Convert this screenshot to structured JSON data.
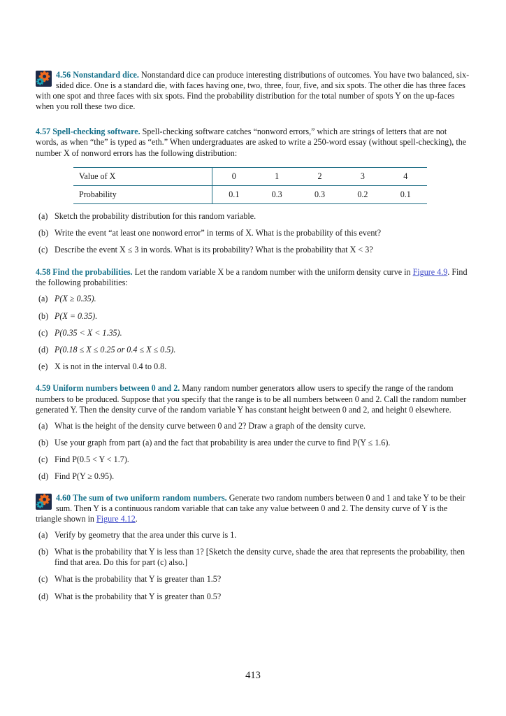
{
  "page": {
    "folio": "413",
    "heading_color": "#15708a",
    "link_color": "#3a46c8",
    "rule_color": "#1b6b83"
  },
  "icons": {
    "gear_badge": "gears-icon"
  },
  "exercises": [
    {
      "id": "4.56",
      "has_icon": true,
      "number": "4.56",
      "title": "Nonstandard dice.",
      "body": "Nonstandard dice can produce interesting distributions of outcomes. You have two balanced, six-sided dice. One is a standard die, with faces having one, two, three, four, five, and six spots. The other die has three faces with one spot and three faces with six spots. Find the probability distribution for the total number of spots Y on the up-faces when you roll these two dice."
    },
    {
      "id": "4.57",
      "has_icon": false,
      "number": "4.57",
      "title": "Spell-checking software.",
      "body": "Spell-checking software catches “nonword errors,” which are strings of letters that are not words, as when “the” is typed as “eth.” When undergraduates are asked to write a 250-word essay (without spell-checking), the number X of nonword errors has the following distribution:",
      "table": {
        "row_labels": [
          "Value of X",
          "Probability"
        ],
        "values_x": [
          "0",
          "1",
          "2",
          "3",
          "4"
        ],
        "values_p": [
          "0.1",
          "0.3",
          "0.3",
          "0.2",
          "0.1"
        ]
      },
      "parts": [
        {
          "tag": "(a)",
          "text": "Sketch the probability distribution for this random variable."
        },
        {
          "tag": "(b)",
          "text": "Write the event “at least one nonword error” in terms of X. What is the probability of this event?"
        },
        {
          "tag": "(c)",
          "text": "Describe the event X ≤ 3 in words. What is its probability? What is the probability that X < 3?"
        }
      ]
    },
    {
      "id": "4.58",
      "has_icon": false,
      "number": "4.58",
      "title": "Find the probabilities.",
      "body_pre": "Let the random variable X be a random number with the uniform density curve in ",
      "link": "Figure 4.9",
      "body_post": ". Find the following probabilities:",
      "parts": [
        {
          "tag": "(a)",
          "text": "P(X ≥ 0.35)."
        },
        {
          "tag": "(b)",
          "text": "P(X = 0.35)."
        },
        {
          "tag": "(c)",
          "text": "P(0.35 < X < 1.35)."
        },
        {
          "tag": "(d)",
          "text": "P(0.18 ≤ X ≤ 0.25 or 0.4 ≤ X ≤ 0.5)."
        },
        {
          "tag": "(e)",
          "text": "X is not in the interval 0.4 to 0.8."
        }
      ]
    },
    {
      "id": "4.59",
      "has_icon": false,
      "number": "4.59",
      "title": "Uniform numbers between 0 and 2.",
      "body": "Many random number generators allow users to specify the range of the random numbers to be produced. Suppose that you specify that the range is to be all numbers between 0 and 2. Call the random number generated Y. Then the density curve of the random variable Y has constant height between 0 and 2, and height 0 elsewhere.",
      "parts": [
        {
          "tag": "(a)",
          "text": "What is the height of the density curve between 0 and 2? Draw a graph of the density curve."
        },
        {
          "tag": "(b)",
          "text": "Use your graph from part (a) and the fact that probability is area under the curve to find P(Y ≤ 1.6)."
        },
        {
          "tag": "(c)",
          "text": "Find P(0.5 < Y < 1.7)."
        },
        {
          "tag": "(d)",
          "text": "Find P(Y ≥ 0.95)."
        }
      ]
    },
    {
      "id": "4.60",
      "has_icon": true,
      "number": "4.60",
      "title": "The sum of two uniform random numbers.",
      "body_pre": "Generate two random numbers between 0 and 1 and take Y to be their sum. Then Y is a continuous random variable that can take any value between 0 and 2. The density curve of Y is the triangle shown in ",
      "link": "Figure 4.12",
      "body_post": ".",
      "parts": [
        {
          "tag": "(a)",
          "text": "Verify by geometry that the area under this curve is 1."
        },
        {
          "tag": "(b)",
          "text": "What is the probability that Y is less than 1? [Sketch the density curve, shade the area that represents the probability, then find that area. Do this for part (c) also.]"
        },
        {
          "tag": "(c)",
          "text": "What is the probability that Y is greater than 1.5?"
        },
        {
          "tag": "(d)",
          "text": "What is the probability that Y is greater than 0.5?"
        }
      ]
    }
  ]
}
